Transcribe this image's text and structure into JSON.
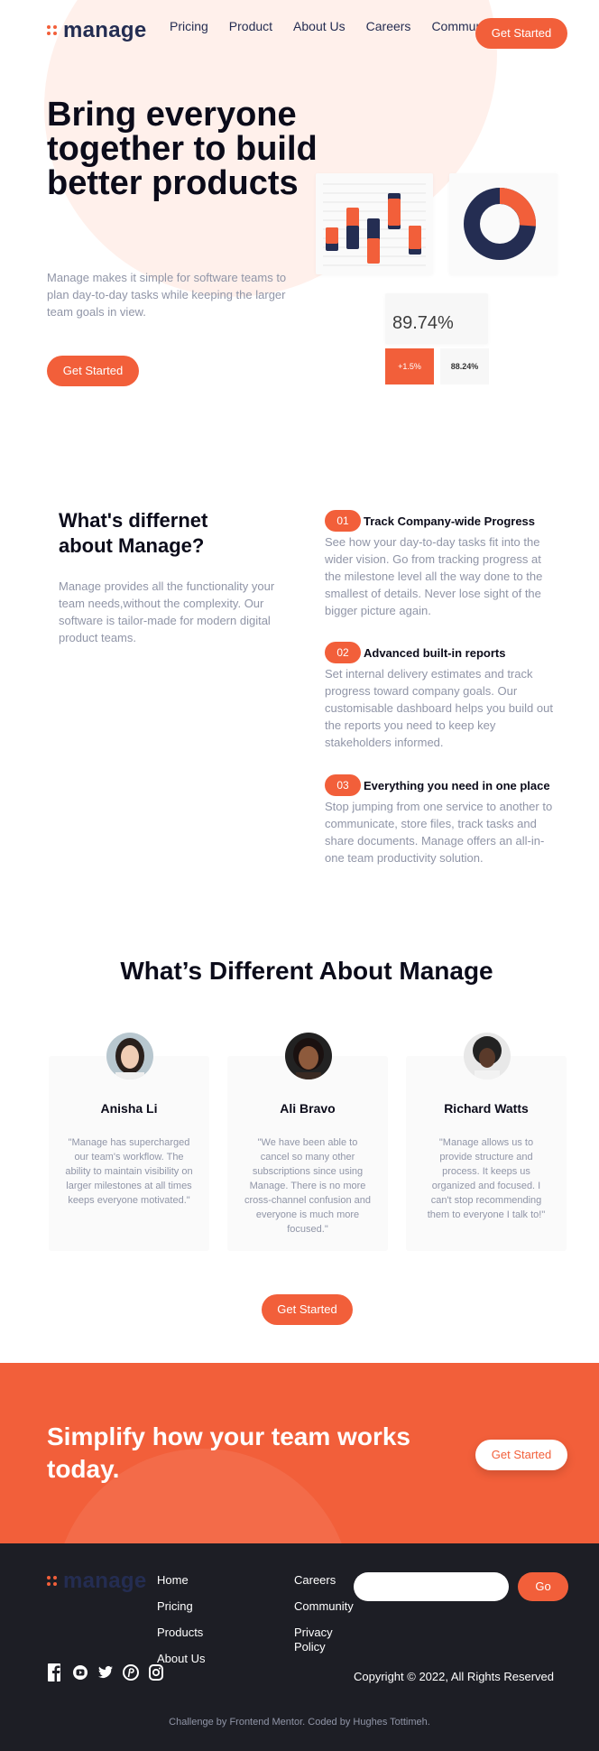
{
  "brand": {
    "name": "manage",
    "accent": "#f25f3a",
    "navy": "#242d52"
  },
  "nav": {
    "items": [
      "Pricing",
      "Product",
      "About Us",
      "Careers",
      "Community"
    ],
    "cta": "Get Started"
  },
  "hero": {
    "title": "Bring everyone together to build better products",
    "text": "Manage makes it simple for software teams to plan day-to-day tasks while keeping the larger team goals in view.",
    "cta": "Get Started",
    "stats": {
      "main": "89.74%",
      "positive": "+1.5%",
      "secondary": "88.24%"
    }
  },
  "different": {
    "title": "What's differnet about Manage?",
    "text": "Manage provides all the functionality your team needs,without the complexity. Our software is tailor-made for modern digital product teams.",
    "features": [
      {
        "num": "01",
        "title": "Track Company-wide Progress",
        "text": "See how your day-to-day tasks fit into the wider vision. Go from tracking progress at the milestone level all the way done to the smallest of details. Never lose sight of the bigger picture again."
      },
      {
        "num": "02",
        "title": "Advanced built-in reports",
        "text": "Set internal delivery estimates and track progress toward company goals. Our customisable dashboard helps you build out the reports you need to keep key stakeholders informed."
      },
      {
        "num": "03",
        "title": "Everything you need in one place",
        "text": "Stop jumping from one service to another to communicate, store files, track tasks and share documents. Manage offers an all-in-one team productivity solution."
      }
    ]
  },
  "testimonials": {
    "title": "What’s Different About Manage",
    "items": [
      {
        "name": "Anisha Li",
        "quote": "\"Manage has supercharged our team's workflow. The ability to maintain visibility on larger milestones at all times keeps everyone motivated.\""
      },
      {
        "name": "Ali Bravo",
        "quote": "\"We have been able to cancel so many other subscriptions since using Manage. There is no more cross-channel confusion and everyone is much more focused.\""
      },
      {
        "name": "Richard Watts",
        "quote": "\"Manage allows us to provide structure and process. It keeps us organized and focused. I can't stop recommending them to everyone I talk to!\""
      }
    ],
    "cta": "Get Started"
  },
  "cta_section": {
    "title": "Simplify how your team works today.",
    "button": "Get Started"
  },
  "footer": {
    "links_col1": [
      "Home",
      "Pricing",
      "Products",
      "About Us"
    ],
    "links_col2": [
      "Careers",
      "Community",
      "Privacy Policy"
    ],
    "input_placeholder": "",
    "go": "Go",
    "socials": [
      "facebook-icon",
      "youtube-icon",
      "twitter-icon",
      "pinterest-icon",
      "instagram-icon"
    ],
    "copyright": "Copyright © 2022, All Rights Reserved",
    "credit": "Challenge by Frontend Mentor. Coded by Hughes Tottimeh."
  }
}
